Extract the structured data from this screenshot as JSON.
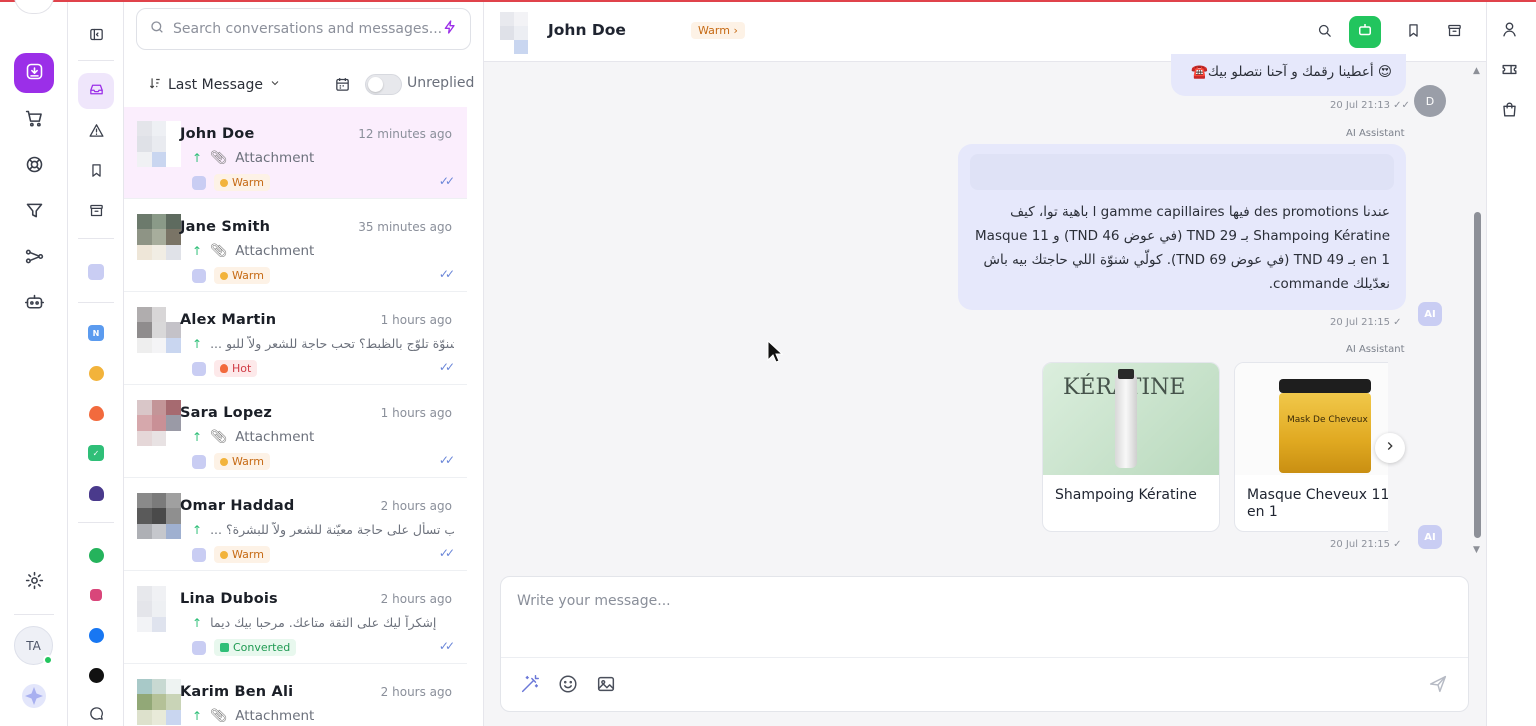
{
  "search": {
    "placeholder": "Search conversations and messages..."
  },
  "sort": {
    "label": "Last Message"
  },
  "unreplied_label": "Unreplied",
  "rail": {
    "avatar_initials": "TA"
  },
  "conversations": [
    {
      "name": "John Doe",
      "time": "12 minutes ago",
      "preview": "Attachment",
      "tag": "Warm"
    },
    {
      "name": "Jane Smith",
      "time": "35 minutes ago",
      "preview": "Attachment",
      "tag": "Warm"
    },
    {
      "name": "Alex Martin",
      "time": "1 hours ago",
      "preview": "شنوّة تلوّج بالظبط؟ تحب حاجة للشعر ولاّ للبو ...",
      "tag": "Hot"
    },
    {
      "name": "Sara Lopez",
      "time": "1 hours ago",
      "preview": "Attachment",
      "tag": "Warm"
    },
    {
      "name": "Omar Haddad",
      "time": "2 hours ago",
      "preview": "تحب تسأل على حاجة معيّنة للشعر ولاّ للبشرة؟ ...",
      "tag": "Warm"
    },
    {
      "name": "Lina Dubois",
      "time": "2 hours ago",
      "preview": "إشكراً ليك على الثقة متاعك. مرحبا بيك ديما",
      "tag": "Converted"
    },
    {
      "name": "Karim Ben Ali",
      "time": "2 hours ago",
      "preview": "Attachment",
      "tag": ""
    }
  ],
  "header": {
    "name": "John Doe",
    "tag": "Warm"
  },
  "messages": {
    "m1_text": "☎️أعطينا رقمك و آحنا نتصلو بيك 😍",
    "m1_meta": "20 Jul 21:13",
    "m1_avatar": "D",
    "ai_label": "AI Assistant",
    "m2_text": "عندنا des promotions فيها l gamme capillaires باهية توا، كيف Shampoing Kératine بـ 29 TND (في عوض 46 TND) و Masque 11 en 1 بـ 49 TND (في عوض 69 TND). كولّي شنوّة اللي حاجتك بيه باش نعدّيلك commande.",
    "m2_meta": "20 Jul 21:15",
    "m3_meta": "20 Jul 21:15",
    "card1_title": "Shampoing Kératine",
    "card2_title": "Masque Cheveux 11 en 1",
    "card1_img_text": "KÉRATINE",
    "card2_img_text": "Mask De Cheveux"
  },
  "composer": {
    "placeholder": "Write your message..."
  },
  "colors": {
    "accent": "#9b2fe8",
    "bot_green": "#22c55e",
    "bubble": "#e6e8fb",
    "warm": "#c66a14"
  }
}
